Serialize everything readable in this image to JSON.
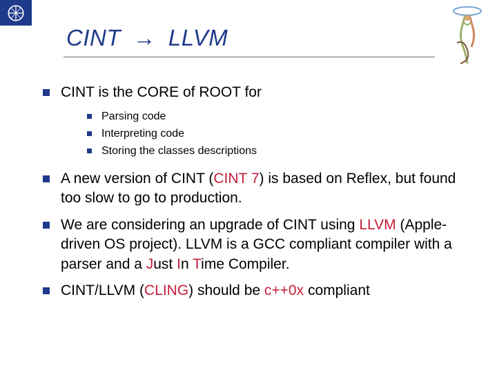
{
  "title": {
    "left": "CINT",
    "arrow": "→",
    "right": "LLVM"
  },
  "bullets": {
    "b1": "CINT is the CORE of ROOT for",
    "sub": {
      "s1": "Parsing code",
      "s2": "Interpreting code",
      "s3": "Storing the classes descriptions"
    },
    "b2_a": "A new version of CINT (",
    "b2_hl": "CINT 7",
    "b2_b": ") is based on Reflex, but found too slow to go to production.",
    "b3_a": "We are considering an upgrade of CINT using ",
    "b3_hl1": "LLVM",
    "b3_b": " (Apple-driven OS project). LLVM is a GCC compliant compiler with a parser and a ",
    "b3_hl2_a": "J",
    "b3_mid1": "ust ",
    "b3_hl2_b": "I",
    "b3_mid2": "n ",
    "b3_hl2_c": "T",
    "b3_c": "ime Compiler.",
    "b4_a": "CINT/LLVM (",
    "b4_hl1": "CLING",
    "b4_b": ") should be ",
    "b4_hl2": "c++0x",
    "b4_c": " compliant"
  }
}
